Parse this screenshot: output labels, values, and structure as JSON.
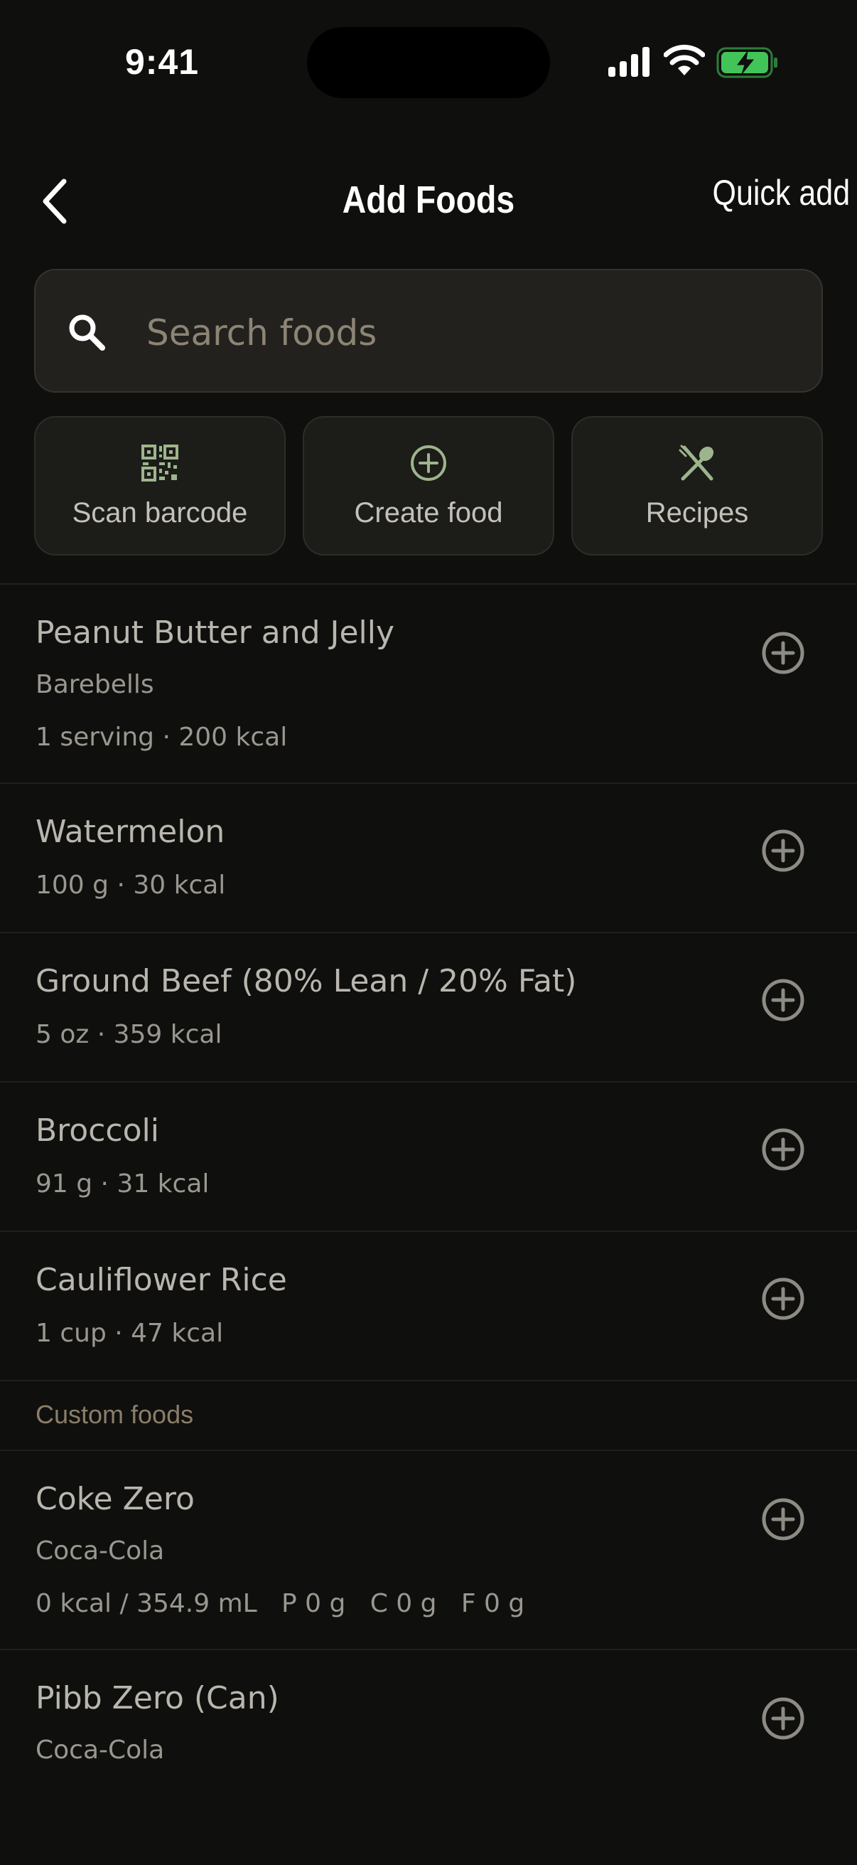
{
  "status": {
    "time": "9:41"
  },
  "nav": {
    "title": "Add Foods",
    "quick_add": "Quick add"
  },
  "search": {
    "placeholder": "Search foods",
    "value": ""
  },
  "actions": [
    {
      "label": "Scan barcode",
      "icon": "barcode-scan-icon"
    },
    {
      "label": "Create food",
      "icon": "plus-circle-icon"
    },
    {
      "label": "Recipes",
      "icon": "utensils-icon"
    }
  ],
  "recent_foods": [
    {
      "name": "Peanut Butter and Jelly",
      "brand": "Barebells",
      "detail": "1 serving · 200 kcal"
    },
    {
      "name": "Watermelon",
      "detail": "100 g · 30 kcal"
    },
    {
      "name": "Ground Beef (80% Lean / 20% Fat)",
      "detail": "5 oz · 359 kcal"
    },
    {
      "name": "Broccoli",
      "detail": "91 g · 31 kcal"
    },
    {
      "name": "Cauliflower Rice",
      "detail": "1 cup · 47 kcal"
    }
  ],
  "custom_section": {
    "title": "Custom foods"
  },
  "custom_foods": [
    {
      "name": "Coke Zero",
      "brand": "Coca-Cola",
      "detail": "0 kcal / 354.9 mL   P 0 g   C 0 g   F 0 g"
    },
    {
      "name": "Pibb Zero (Can)",
      "brand": "Coca-Cola"
    }
  ],
  "colors": {
    "background": "#0f0f0e",
    "accent_green": "#9db58c",
    "section_header": "#8b7e69",
    "battery_green": "#43c459"
  }
}
